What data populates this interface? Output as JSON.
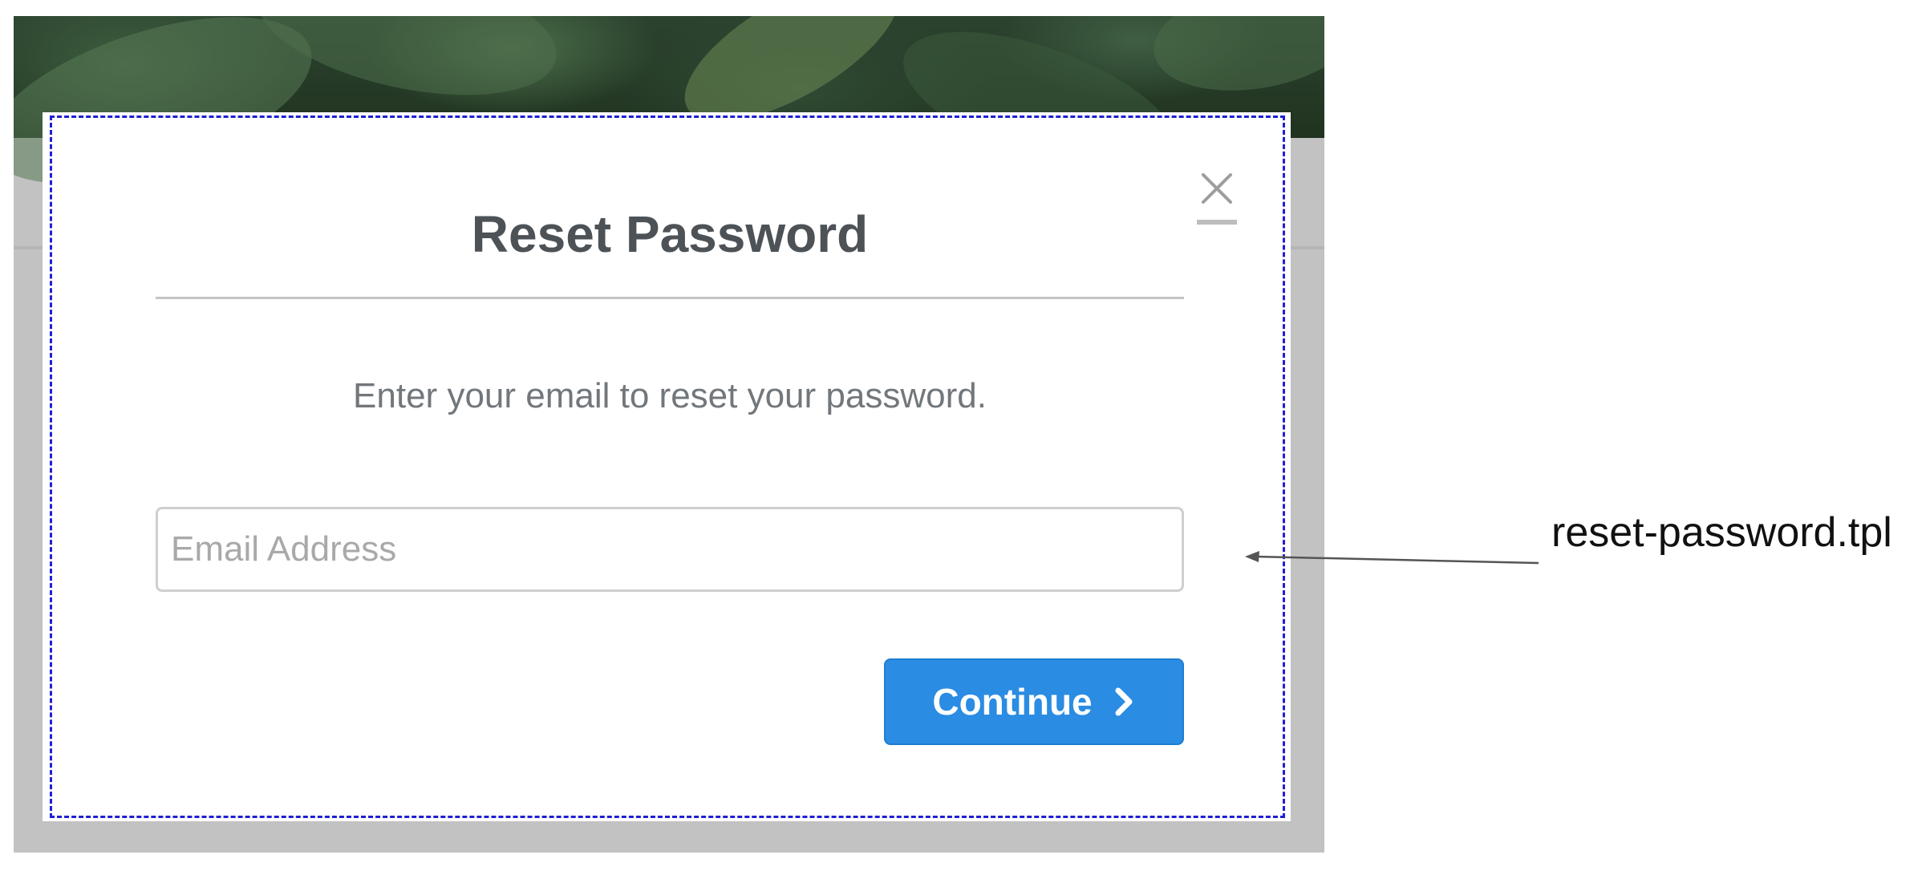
{
  "modal": {
    "title": "Reset Password",
    "instructions": "Enter your email to reset your password.",
    "email_placeholder": "Email Address",
    "email_value": "",
    "continue_label": "Continue",
    "close_icon": "close-icon"
  },
  "annotation": {
    "label": "reset-password.tpl"
  },
  "colors": {
    "primary_button": "#2a8ce3",
    "title_text": "#4d5257",
    "body_text": "#72777c",
    "overlay": "#c2c2c2",
    "annotation_outline": "#1f1fd6"
  }
}
